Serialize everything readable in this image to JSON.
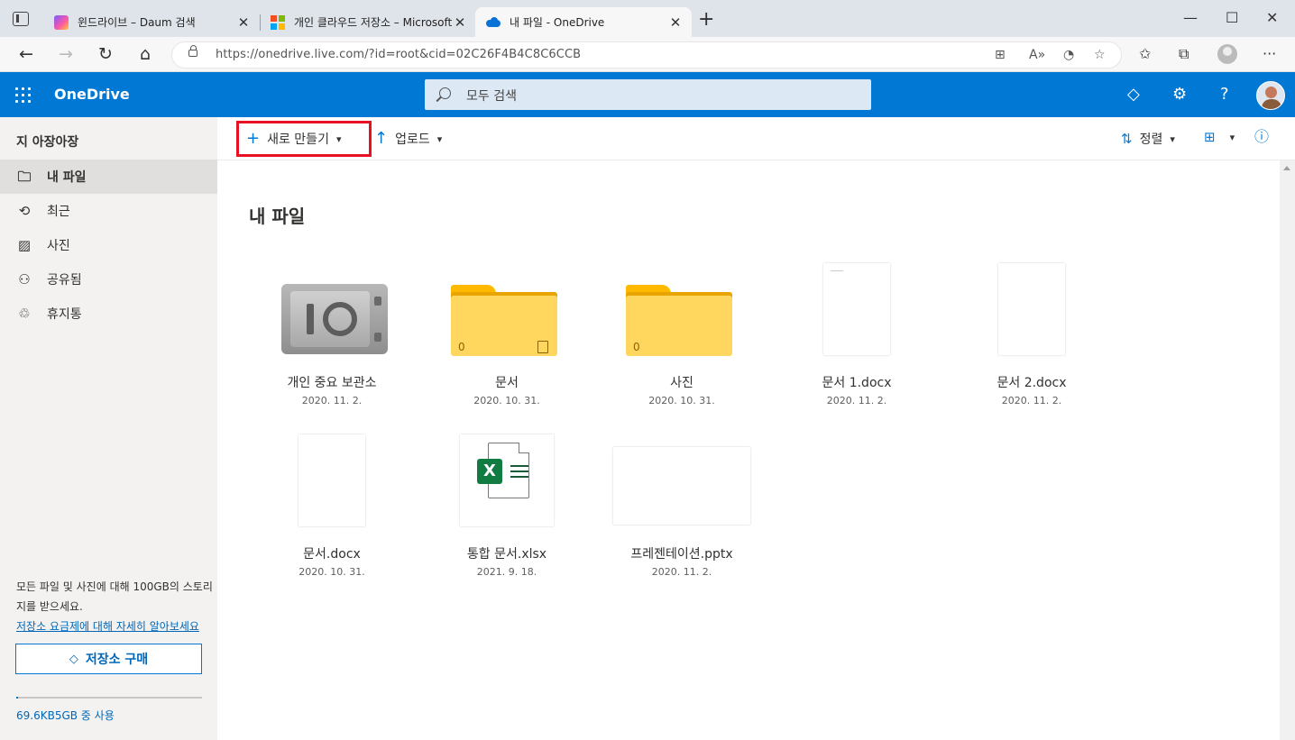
{
  "browser": {
    "tabs": [
      {
        "title": "윈드라이브 – Daum 검색",
        "favicon": "daum-icon",
        "active": false
      },
      {
        "title": "개인 클라우드 저장소 – Microsoft",
        "favicon": "microsoft-icon",
        "active": false
      },
      {
        "title": "내 파일 - OneDrive",
        "favicon": "onedrive-cloud-icon",
        "active": true
      }
    ],
    "close_glyph": "✕",
    "new_tab_glyph": "+",
    "url": "https://onedrive.live.com/?id=root&cid=02C26F4B4C8C6CCB"
  },
  "header": {
    "app_name": "OneDrive",
    "search_placeholder": "모두 검색",
    "help_glyph": "?",
    "accent": "#0078d4"
  },
  "sidebar": {
    "user_name": "지 아장아장",
    "items": [
      {
        "label": "내 파일",
        "icon": "folder-icon",
        "selected": true
      },
      {
        "label": "최근",
        "icon": "history-icon",
        "selected": false
      },
      {
        "label": "사진",
        "icon": "photo-icon",
        "selected": false
      },
      {
        "label": "공유됨",
        "icon": "people-icon",
        "selected": false
      },
      {
        "label": "휴지통",
        "icon": "recycle-bin-icon",
        "selected": false
      }
    ],
    "promo_text": "모든 파일 및 사진에 대해 100GB의 스토리지를 받으세요.",
    "promo_link": "저장소 요금제에 대해 자세히 알아보세요",
    "buy_label": "저장소 구매",
    "quota_text": "69.6KB5GB 중 사용",
    "quota_used_fraction": 0.01
  },
  "commandbar": {
    "new_label": "새로 만들기",
    "upload_label": "업로드",
    "sort_label": "정렬"
  },
  "main": {
    "title": "내 파일",
    "items": [
      {
        "name": "개인 중요 보관소",
        "date": "2020. 11. 2.",
        "kind": "vault"
      },
      {
        "name": "문서",
        "date": "2020. 10. 31.",
        "kind": "folder",
        "count": "0",
        "shared_doc": true
      },
      {
        "name": "사진",
        "date": "2020. 10. 31.",
        "kind": "folder",
        "count": "0"
      },
      {
        "name": "문서 1.docx",
        "date": "2020. 11. 2.",
        "kind": "docx"
      },
      {
        "name": "문서 2.docx",
        "date": "2020. 11. 2.",
        "kind": "docx"
      },
      {
        "name": "문서.docx",
        "date": "2020. 10. 31.",
        "kind": "docx"
      },
      {
        "name": "통합 문서.xlsx",
        "date": "2021. 9. 18.",
        "kind": "xlsx",
        "badge": "X"
      },
      {
        "name": "프레젠테이션.pptx",
        "date": "2020. 11. 2.",
        "kind": "pptx"
      }
    ]
  }
}
